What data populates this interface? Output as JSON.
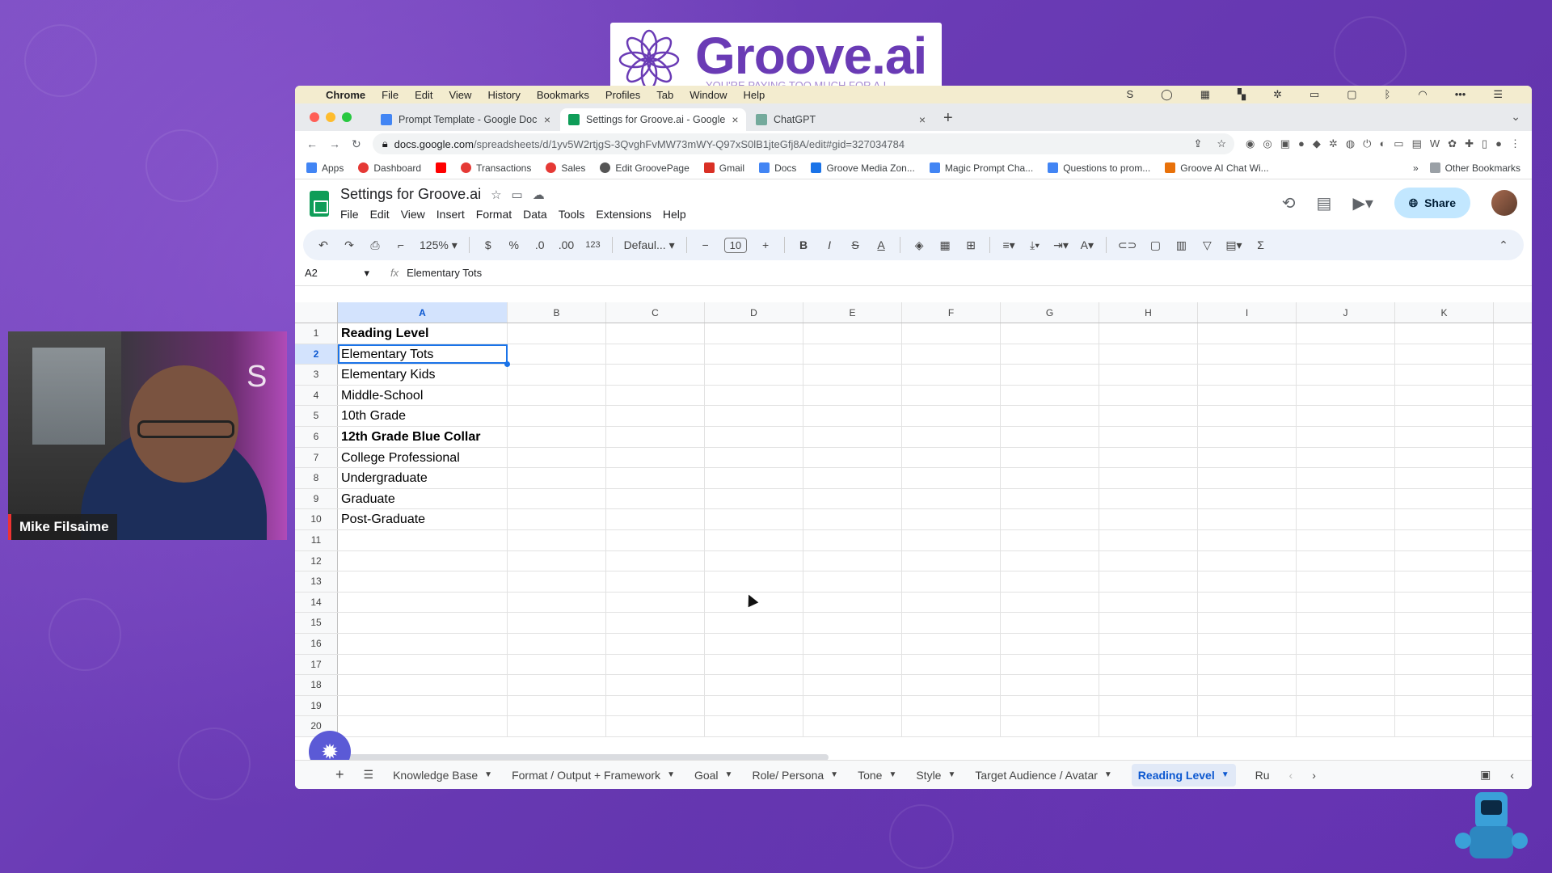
{
  "logo": {
    "text": "Groove.ai",
    "tagline": "YOU'RE PAYING TOO MUCH FOR A.I."
  },
  "webcam": {
    "name": "Mike Filsaime"
  },
  "mac_menu": {
    "app": "Chrome",
    "items": [
      "File",
      "Edit",
      "View",
      "History",
      "Bookmarks",
      "Profiles",
      "Tab",
      "Window",
      "Help"
    ]
  },
  "browser": {
    "tabs": [
      {
        "title": "Prompt Template - Google Doc",
        "color": "#4285f4",
        "active": false
      },
      {
        "title": "Settings for Groove.ai - Google",
        "color": "#0f9d58",
        "active": true
      },
      {
        "title": "ChatGPT",
        "color": "#74aa9c",
        "active": false
      }
    ],
    "url_host": "docs.google.com",
    "url_path": "/spreadsheets/d/1yv5W2rtjgS-3QvghFvMW73mWY-Q97xS0lB1jteGfj8A/edit#gid=327034784",
    "bookmarks": [
      "Apps",
      "Dashboard",
      "",
      "Transactions",
      "Sales",
      "Edit GroovePage",
      "Gmail",
      "Docs",
      "Groove Media Zon...",
      "Magic Prompt Cha...",
      "Questions to prom...",
      "Groove AI Chat Wi..."
    ],
    "bookmarks_more": "»",
    "other_bookmarks": "Other Bookmarks"
  },
  "sheets": {
    "title": "Settings for Groove.ai",
    "menus": [
      "File",
      "Edit",
      "View",
      "Insert",
      "Format",
      "Data",
      "Tools",
      "Extensions",
      "Help"
    ],
    "share_label": "Share",
    "toolbar": {
      "zoom": "125%",
      "currency": "$",
      "percent": "%",
      "dec_less": ".0",
      "dec_more": ".00",
      "format_num": "123",
      "font": "Defaul...",
      "font_size": "10"
    },
    "name_box": "A2",
    "formula": "Elementary Tots",
    "columns": [
      "A",
      "B",
      "C",
      "D",
      "E",
      "F",
      "G",
      "H",
      "I",
      "J",
      "K"
    ],
    "rows": [
      "1",
      "2",
      "3",
      "4",
      "5",
      "6",
      "7",
      "8",
      "9",
      "10",
      "11",
      "12",
      "13",
      "14",
      "15",
      "16",
      "17",
      "18",
      "19",
      "20"
    ],
    "col_a": [
      "Reading Level",
      "Elementary Tots",
      "Elementary Kids",
      "Middle-School",
      "10th Grade",
      "12th Grade Blue Collar",
      "College Professional",
      "Undergraduate",
      "Graduate",
      "Post-Graduate",
      "",
      "",
      "",
      "",
      "",
      "",
      "",
      "",
      "",
      ""
    ],
    "sheet_tabs": [
      "Knowledge Base",
      "Format / Output  + Framework",
      "Goal",
      "Role/ Persona",
      "Tone",
      "Style",
      "Target Audience / Avatar",
      "Reading Level",
      "Ru"
    ],
    "active_tab": "Reading Level"
  }
}
